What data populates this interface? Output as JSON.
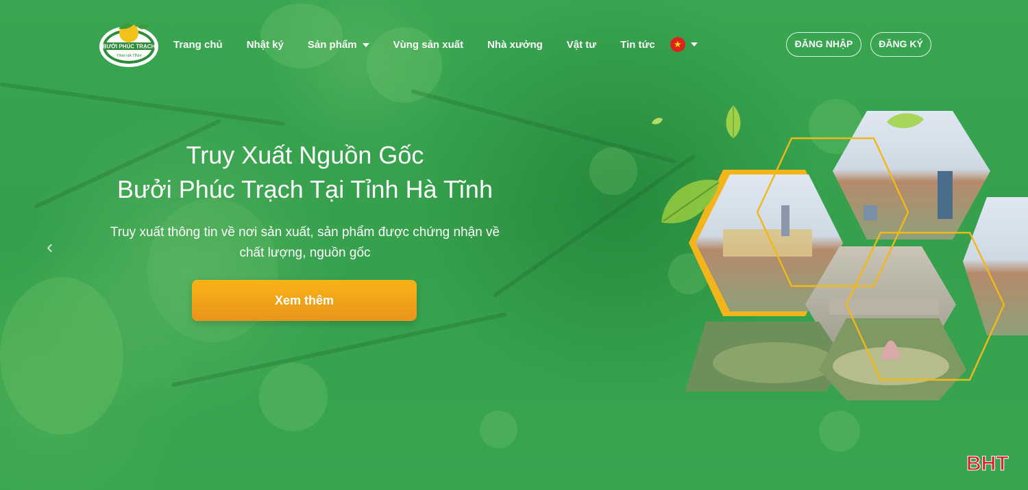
{
  "logo": {
    "name": "Bưởi Phúc Trạch Tỉnh Hà Tĩnh",
    "text_top": "BƯỞI PHÚC TRẠCH",
    "text_bottom": "TỈNH HÀ TĨNH"
  },
  "nav": {
    "items": [
      {
        "label": "Trang chủ"
      },
      {
        "label": "Nhật ký"
      },
      {
        "label": "Sản phẩm",
        "dropdown": true
      },
      {
        "label": "Vùng sản xuất"
      },
      {
        "label": "Nhà xưởng"
      },
      {
        "label": "Vật tư"
      },
      {
        "label": "Tin tức"
      }
    ],
    "language_icon": "vietnam-flag-icon"
  },
  "auth": {
    "login_label": "ĐĂNG NHẬP",
    "register_label": "ĐĂNG KÝ"
  },
  "hero": {
    "title_line1": "Truy Xuất Nguồn Gốc",
    "title_line2": "Bưởi Phúc Trạch Tại Tỉnh Hà Tĩnh",
    "subtitle_line1": "Truy xuất thông tin về nơi sản xuất, sản phẩm được chứng nhận về",
    "subtitle_line2": "chất lượng, nguồn gốc",
    "cta_label": "Xem thêm",
    "prev_icon": "chevron-left-icon",
    "next_icon": "chevron-right-icon"
  },
  "watermark": "BHT",
  "colors": {
    "primary_green": "#36a04c",
    "cta_orange": "#f4a81a",
    "hex_border": "#f1b81a",
    "flag_red": "#da251d"
  }
}
